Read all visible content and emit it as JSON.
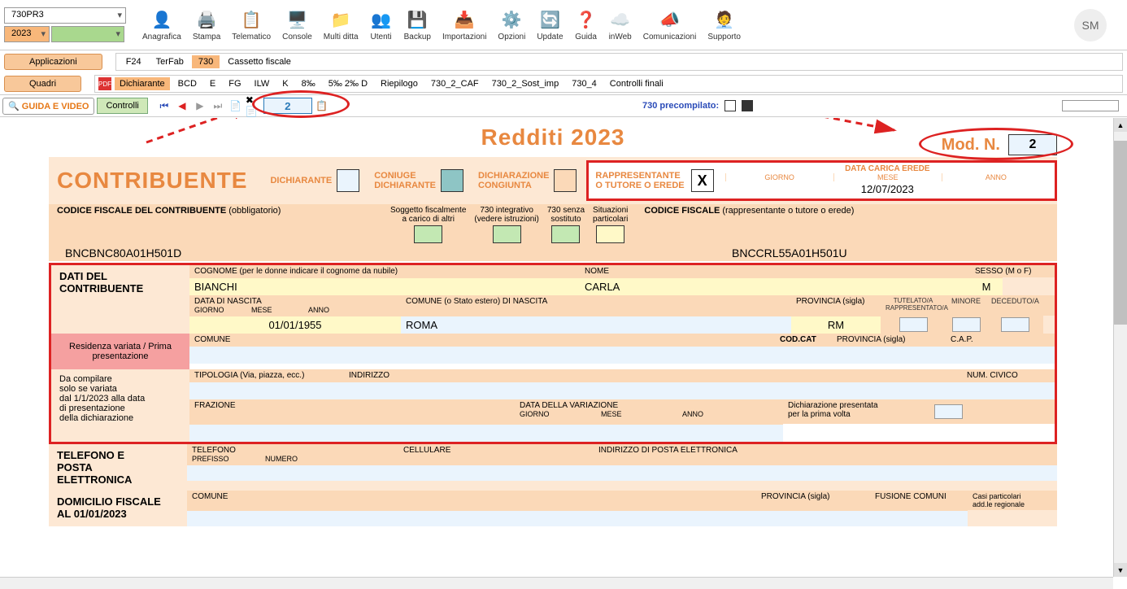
{
  "ribbon": {
    "combo1": "730PR3",
    "year": "2023",
    "icons": [
      {
        "name": "anagrafica",
        "label": "Anagrafica"
      },
      {
        "name": "stampa",
        "label": "Stampa"
      },
      {
        "name": "telematico",
        "label": "Telematico"
      },
      {
        "name": "console",
        "label": "Console"
      },
      {
        "name": "multiditta",
        "label": "Multi ditta"
      },
      {
        "name": "utenti",
        "label": "Utenti"
      },
      {
        "name": "backup",
        "label": "Backup"
      },
      {
        "name": "importazioni",
        "label": "Importazioni"
      },
      {
        "name": "opzioni",
        "label": "Opzioni"
      },
      {
        "name": "update",
        "label": "Update"
      },
      {
        "name": "guida",
        "label": "Guida"
      },
      {
        "name": "inweb",
        "label": "inWeb"
      },
      {
        "name": "comunicazioni",
        "label": "Comunicazioni"
      },
      {
        "name": "supporto",
        "label": "Supporto"
      }
    ],
    "avatar": "SM"
  },
  "buttons": {
    "applicazioni": "Applicazioni",
    "quadri": "Quadri"
  },
  "tabs": [
    "F24",
    "TerFab",
    "730",
    "Cassetto fiscale"
  ],
  "active_tab": "730",
  "subtabs": [
    "Dichiarante",
    "BCD",
    "E",
    "FG",
    "ILW",
    "K",
    "8‰",
    "5‰ 2‰ D",
    "Riepilogo",
    "730_2_CAF",
    "730_2_Sost_imp",
    "730_4",
    "Controlli finali"
  ],
  "active_subtab": "Dichiarante",
  "toolbar": {
    "guida": "GUIDA E VIDEO",
    "controlli": "Controlli",
    "page": "2",
    "precomp": "730 precompilato:"
  },
  "form": {
    "title": "Redditi 2023",
    "mod_n_label": "Mod. N.",
    "mod_n_value": "2",
    "contribuente": "CONTRIBUENTE",
    "dichiarante": "DICHIARANTE",
    "coniuge": "CONIUGE\nDICHIARANTE",
    "congiunta": "DICHIARAZIONE\nCONGIUNTA",
    "rappresentante": "RAPPRESENTANTE\nO TUTORE O EREDE",
    "rap_x": "X",
    "data_carica": "DATA CARICA EREDE",
    "giorno": "GIORNO",
    "mese": "MESE",
    "anno": "ANNO",
    "data_carica_val": "12/07/2023",
    "cf_contrib_lbl": "CODICE FISCALE DEL CONTRIBUENTE",
    "obbl": "(obbligatorio)",
    "sogg_fisc": "Soggetto fiscalmente\na carico di altri",
    "integr": "730 integrativo\n(vedere istruzioni)",
    "senza_sost": "730 senza\nsostituto",
    "sit_part": "Situazioni\nparticolari",
    "cf_rap_lbl": "CODICE FISCALE",
    "cf_rap_sub": "(rappresentante o tutore o erede)",
    "cf_contrib_val": "BNCBNC80A01H501D",
    "cf_rap_val": "BNCCRL55A01H501U",
    "dati_del": "DATI DEL\nCONTRIBUENTE",
    "cognome_lbl": "COGNOME (per le donne indicare il cognome da nubile)",
    "nome_lbl": "NOME",
    "sesso_lbl": "SESSO (M o F)",
    "cognome_val": "BIANCHI",
    "nome_val": "CARLA",
    "sesso_val": "M",
    "data_nascita_lbl": "DATA DI NASCITA",
    "comune_nascita_lbl": "COMUNE (o Stato estero) DI NASCITA",
    "prov_lbl": "PROVINCIA (sigla)",
    "tutelato": "TUTELATO/A\nRAPPRESENTATO/A",
    "minore": "MINORE",
    "deceduto": "DECEDUTO/A",
    "data_nascita_val": "01/01/1955",
    "comune_nascita_val": "ROMA",
    "prov_nascita_val": "RM",
    "residenza": "Residenza variata / Prima presentazione",
    "comune_lbl": "COMUNE",
    "codcat": "COD.CAT",
    "cap": "C.A.P.",
    "compilare": "Da compilare\nsolo se variata\ndal 1/1/2023 alla data\ndi presentazione\ndella dichiarazione",
    "tipologia": "TIPOLOGIA (Via, piazza, ecc.)",
    "indirizzo": "INDIRIZZO",
    "numcivico": "NUM. CIVICO",
    "frazione": "FRAZIONE",
    "data_var": "DATA DELLA VARIAZIONE",
    "prima_volta": "Dichiarazione presentata\nper la prima volta",
    "tel_posta": "TELEFONO E\nPOSTA\nELETTRONICA",
    "telefono": "TELEFONO",
    "prefisso": "PREFISSO",
    "numero": "NUMERO",
    "cellulare": "CELLULARE",
    "email": "INDIRIZZO DI POSTA ELETTRONICA",
    "domicilio": "DOMICILIO FISCALE\nAL 01/01/2023",
    "fusione": "FUSIONE COMUNI",
    "casi_part": "Casi particolari\nadd.le regionale"
  }
}
